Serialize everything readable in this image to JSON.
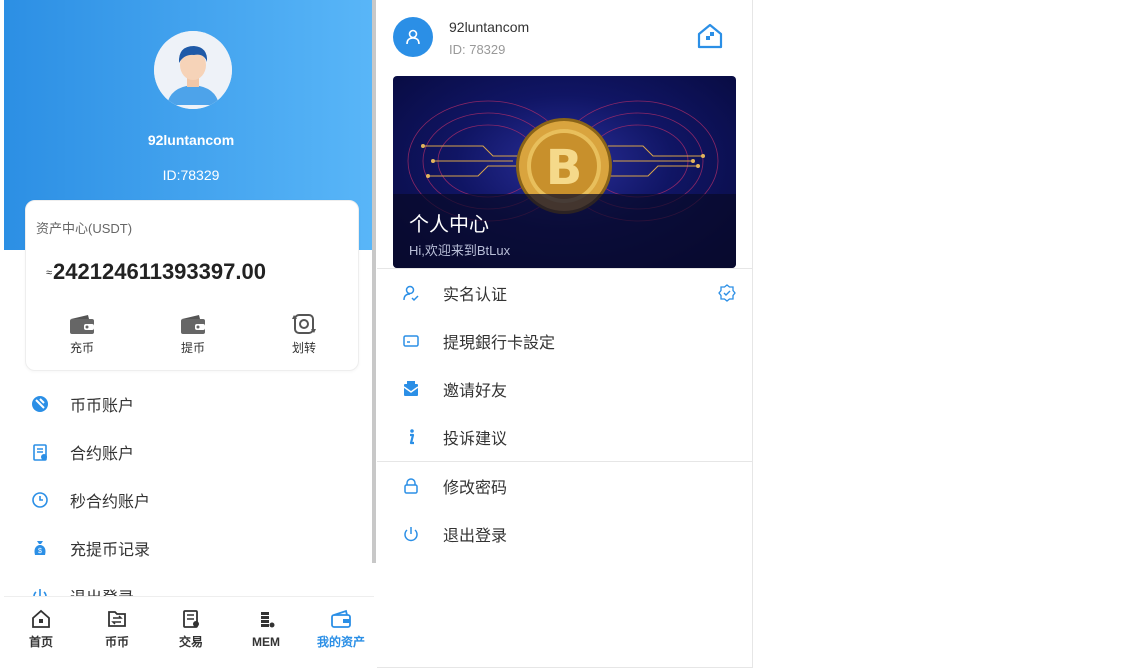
{
  "left": {
    "username": "92luntancom",
    "user_id": "ID:78329",
    "asset_card": {
      "title": "资产中心(USDT)",
      "approx_symbol": "≈",
      "value": "242124611393397.00",
      "actions": [
        {
          "label": "充币",
          "icon": "wallet-icon"
        },
        {
          "label": "提币",
          "icon": "wallet-icon"
        },
        {
          "label": "划转",
          "icon": "transfer-icon"
        }
      ]
    },
    "menu": [
      {
        "label": "币币账户",
        "icon": "coin-account-icon"
      },
      {
        "label": "合约账户",
        "icon": "contract-account-icon"
      },
      {
        "label": "秒合约账户",
        "icon": "clock-icon"
      },
      {
        "label": "充提币记录",
        "icon": "money-bag-icon"
      },
      {
        "label": "退出登录",
        "icon": "power-icon"
      }
    ],
    "tabbar": [
      {
        "label": "首页",
        "icon": "home-icon"
      },
      {
        "label": "币币",
        "icon": "exchange-icon"
      },
      {
        "label": "交易",
        "icon": "trade-icon"
      },
      {
        "label": "MEM",
        "icon": "coins-stack-icon"
      },
      {
        "label": "我的资产",
        "icon": "wallet-icon",
        "active": true
      }
    ]
  },
  "right": {
    "username": "92luntancom",
    "user_id": "ID: 78329",
    "banner": {
      "title": "个人中心",
      "subtitle": "Hi,欢迎来到BtLux"
    },
    "menu_group1": [
      {
        "label": "实名认证",
        "icon": "user-verify-icon",
        "badge": "verified-badge-icon"
      },
      {
        "label": "提現銀行卡設定",
        "icon": "bank-card-icon"
      },
      {
        "label": "邀请好友",
        "icon": "invite-mail-icon"
      },
      {
        "label": "投诉建议",
        "icon": "info-icon"
      }
    ],
    "menu_group2": [
      {
        "label": "修改密码",
        "icon": "lock-icon"
      },
      {
        "label": "退出登录",
        "icon": "power-icon"
      }
    ]
  },
  "colors": {
    "accent": "#2b8fe6",
    "hero_start": "#2c8fe4",
    "hero_end": "#59b6f8",
    "banner_bg": "#101564"
  }
}
